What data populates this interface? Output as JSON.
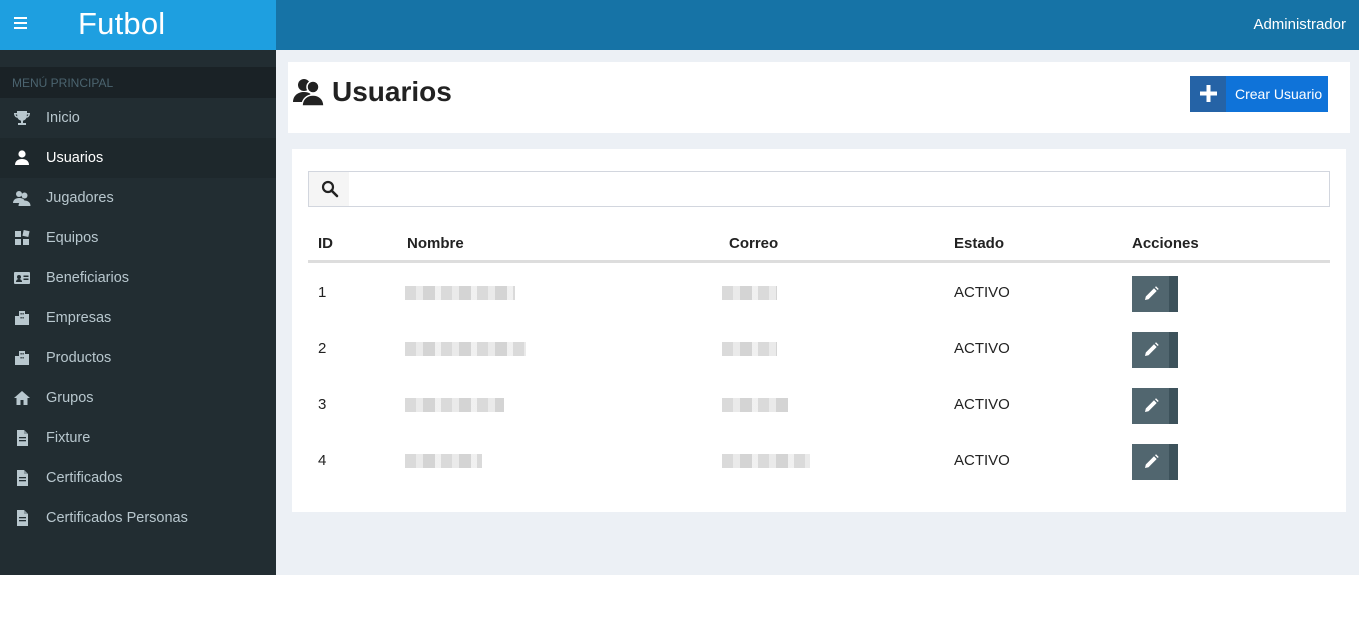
{
  "app": {
    "brand": "Futbol",
    "user": "Administrador"
  },
  "sidebar": {
    "header": "MENÚ PRINCIPAL",
    "items": [
      {
        "label": "Inicio",
        "icon": "trophy-icon"
      },
      {
        "label": "Usuarios",
        "icon": "user-icon",
        "active": true
      },
      {
        "label": "Jugadores",
        "icon": "users-icon"
      },
      {
        "label": "Equipos",
        "icon": "grid-icon"
      },
      {
        "label": "Beneficiarios",
        "icon": "id-card-icon"
      },
      {
        "label": "Empresas",
        "icon": "building-icon"
      },
      {
        "label": "Productos",
        "icon": "building-icon"
      },
      {
        "label": "Grupos",
        "icon": "home-icon"
      },
      {
        "label": "Fixture",
        "icon": "document-icon"
      },
      {
        "label": "Certificados",
        "icon": "document-icon"
      },
      {
        "label": "Certificados Personas",
        "icon": "document-icon"
      }
    ]
  },
  "page": {
    "title": "Usuarios",
    "create_button": "Crear Usuario"
  },
  "search": {
    "placeholder": ""
  },
  "table": {
    "headers": {
      "id": "ID",
      "name": "Nombre",
      "email": "Correo",
      "status": "Estado",
      "actions": "Acciones"
    },
    "rows": [
      {
        "id": "1",
        "status": "ACTIVO"
      },
      {
        "id": "2",
        "status": "ACTIVO"
      },
      {
        "id": "3",
        "status": "ACTIVO"
      },
      {
        "id": "4",
        "status": "ACTIVO"
      }
    ]
  },
  "colors": {
    "brand": "#1e9fe0",
    "topbar": "#1673a6",
    "sidebar": "#222d32",
    "primary_button": "#0f73d9",
    "edit_button": "#51666f"
  }
}
